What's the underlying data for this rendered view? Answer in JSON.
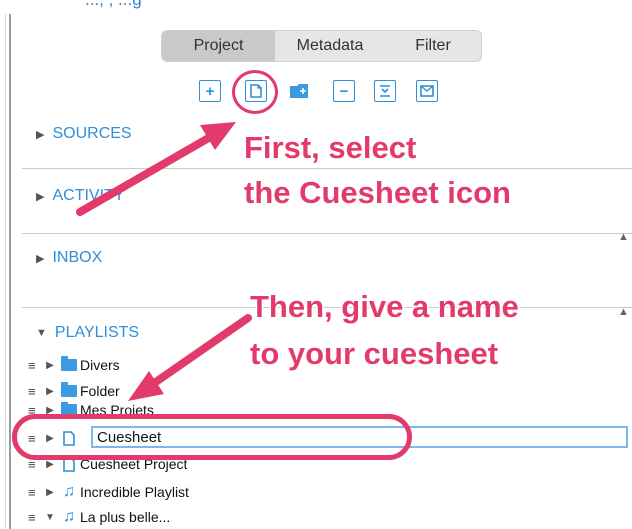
{
  "top_link_fragment": "..., , ...g",
  "tabs": [
    "Project",
    "Metadata",
    "Filter"
  ],
  "toolbar": [
    {
      "name": "add-button",
      "glyph": "+"
    },
    {
      "name": "new-cuesheet-button",
      "glyph": "cuesheet"
    },
    {
      "name": "new-folder-button",
      "glyph": "folder"
    },
    {
      "name": "remove-button",
      "glyph": "−"
    },
    {
      "name": "collapse-button",
      "glyph": "collapse"
    },
    {
      "name": "mail-button",
      "glyph": "mail"
    }
  ],
  "sections": {
    "sources": "SOURCES",
    "activity": "ACTIVITY",
    "inbox": "INBOX",
    "playlists": "PLAYLISTS"
  },
  "playlists": [
    {
      "label": "Divers",
      "icon": "folder-icon"
    },
    {
      "label": "Folder",
      "icon": "folder-icon"
    },
    {
      "label": "Mes Projets",
      "icon": "folder-icon"
    },
    {
      "label": "Cuesheet",
      "icon": "cuesheet-icon"
    },
    {
      "label": "Cuesheet Project",
      "icon": "cuesheet-icon"
    },
    {
      "label": "Incredible Playlist",
      "icon": "music-note-icon"
    },
    {
      "label": "La plus belle...",
      "icon": "music-note-icon"
    }
  ],
  "new_item_value": "Cuesheet",
  "annotations": {
    "first_line1": "First, select",
    "first_line2": "the Cuesheet icon",
    "then_line1": "Then, give a name",
    "then_line2": "to your cuesheet"
  },
  "colors": {
    "accent": "#2f8fd8",
    "annotation": "#e23a6b",
    "folder": "#3b9ae1"
  }
}
